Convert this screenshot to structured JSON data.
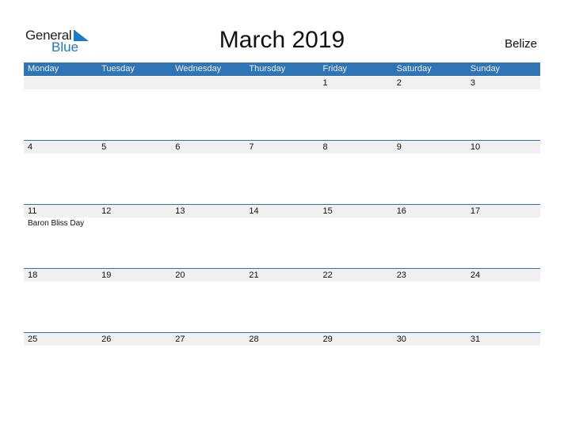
{
  "logo": {
    "part1": "General",
    "part2": "Blue"
  },
  "title": "March 2019",
  "country": "Belize",
  "colors": {
    "header_bg": "#2f75b6",
    "date_strip": "#f0f0f0",
    "brand_blue": "#1f78c8"
  },
  "weekdays": [
    "Monday",
    "Tuesday",
    "Wednesday",
    "Thursday",
    "Friday",
    "Saturday",
    "Sunday"
  ],
  "weeks": [
    {
      "days": [
        {
          "num": "",
          "event": ""
        },
        {
          "num": "",
          "event": ""
        },
        {
          "num": "",
          "event": ""
        },
        {
          "num": "",
          "event": ""
        },
        {
          "num": "1",
          "event": ""
        },
        {
          "num": "2",
          "event": ""
        },
        {
          "num": "3",
          "event": ""
        }
      ]
    },
    {
      "days": [
        {
          "num": "4",
          "event": ""
        },
        {
          "num": "5",
          "event": ""
        },
        {
          "num": "6",
          "event": ""
        },
        {
          "num": "7",
          "event": ""
        },
        {
          "num": "8",
          "event": ""
        },
        {
          "num": "9",
          "event": ""
        },
        {
          "num": "10",
          "event": ""
        }
      ]
    },
    {
      "days": [
        {
          "num": "11",
          "event": "Baron Bliss Day"
        },
        {
          "num": "12",
          "event": ""
        },
        {
          "num": "13",
          "event": ""
        },
        {
          "num": "14",
          "event": ""
        },
        {
          "num": "15",
          "event": ""
        },
        {
          "num": "16",
          "event": ""
        },
        {
          "num": "17",
          "event": ""
        }
      ]
    },
    {
      "days": [
        {
          "num": "18",
          "event": ""
        },
        {
          "num": "19",
          "event": ""
        },
        {
          "num": "20",
          "event": ""
        },
        {
          "num": "21",
          "event": ""
        },
        {
          "num": "22",
          "event": ""
        },
        {
          "num": "23",
          "event": ""
        },
        {
          "num": "24",
          "event": ""
        }
      ]
    },
    {
      "days": [
        {
          "num": "25",
          "event": ""
        },
        {
          "num": "26",
          "event": ""
        },
        {
          "num": "27",
          "event": ""
        },
        {
          "num": "28",
          "event": ""
        },
        {
          "num": "29",
          "event": ""
        },
        {
          "num": "30",
          "event": ""
        },
        {
          "num": "31",
          "event": ""
        }
      ]
    }
  ]
}
